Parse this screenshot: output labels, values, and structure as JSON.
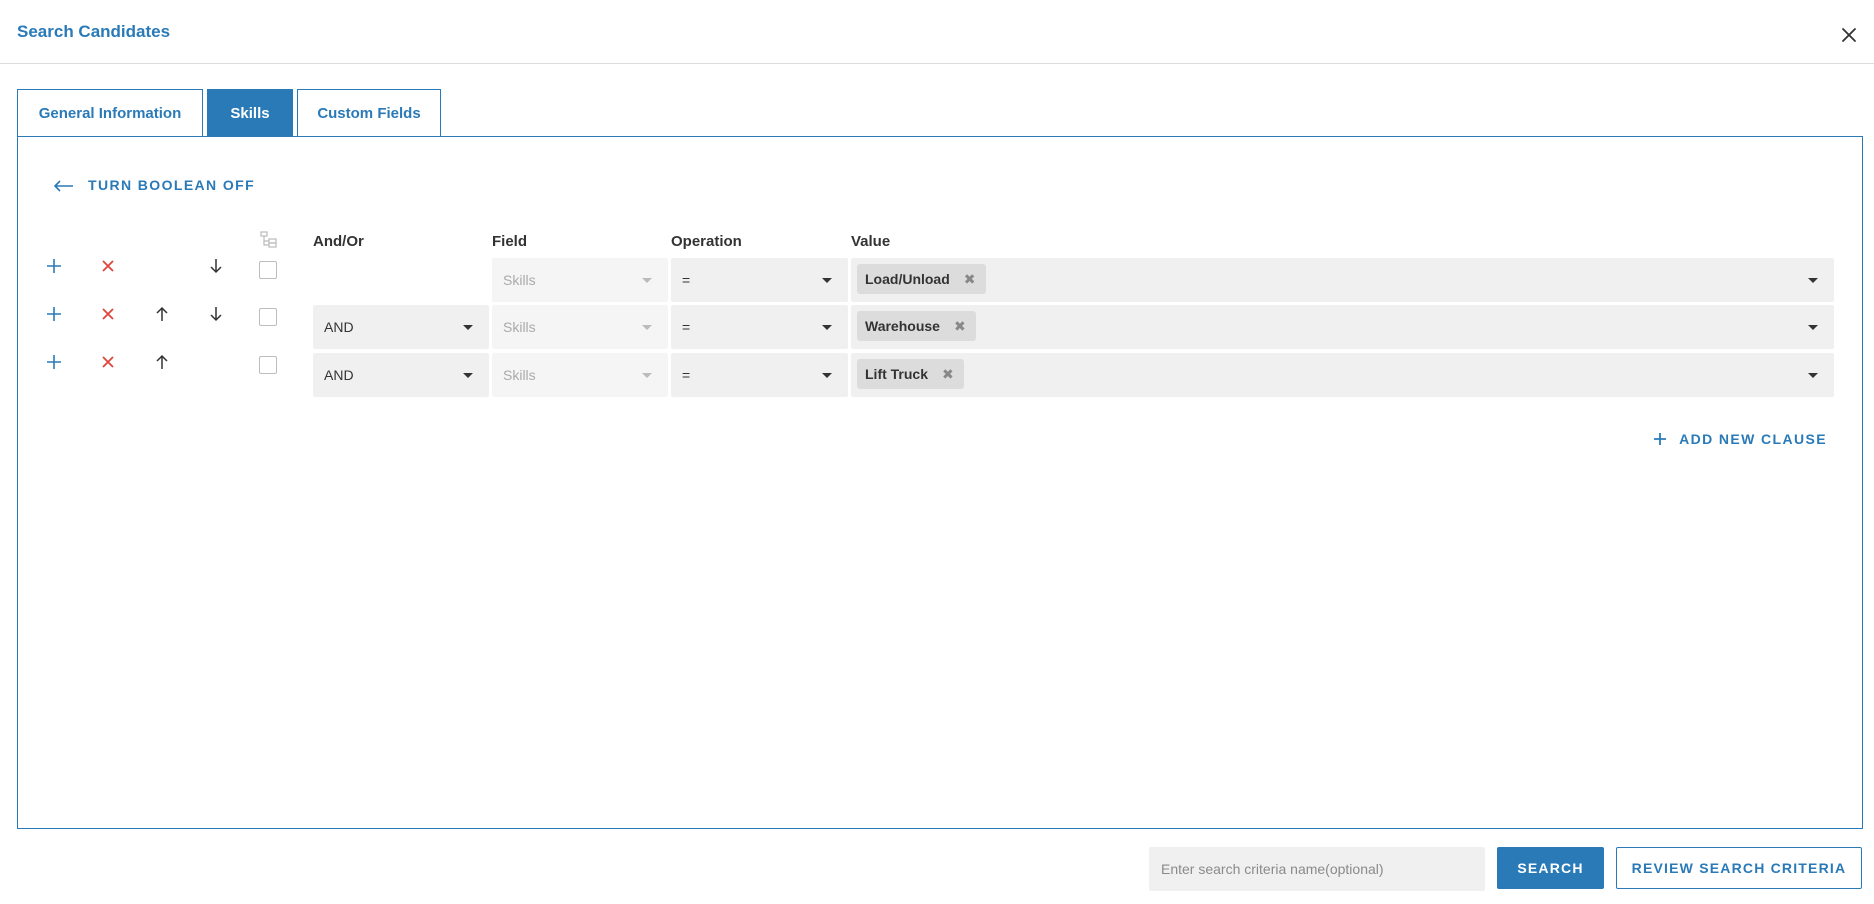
{
  "dialog": {
    "title": "Search Candidates"
  },
  "tabs": [
    {
      "label": "General Information",
      "active": false
    },
    {
      "label": "Skills",
      "active": true
    },
    {
      "label": "Custom Fields",
      "active": false
    }
  ],
  "boolean_toggle": {
    "label": "TURN BOOLEAN OFF"
  },
  "columns": {
    "and_or": "And/Or",
    "field": "Field",
    "operation": "Operation",
    "value": "Value"
  },
  "clauses": [
    {
      "and_or": "",
      "field": "Skills",
      "operation": "=",
      "values": [
        "Load/Unload"
      ]
    },
    {
      "and_or": "AND",
      "field": "Skills",
      "operation": "=",
      "values": [
        "Warehouse"
      ]
    },
    {
      "and_or": "AND",
      "field": "Skills",
      "operation": "=",
      "values": [
        "Lift Truck"
      ]
    }
  ],
  "add_clause": {
    "label": "ADD NEW CLAUSE"
  },
  "footer": {
    "criteria_placeholder": "Enter search criteria name(optional)",
    "search_label": "SEARCH",
    "review_label": "REVIEW SEARCH CRITERIA"
  },
  "colors": {
    "accent": "#2a7ab8",
    "danger": "#e0453c",
    "field_bg": "#f0f0f0",
    "chip_bg": "#dcdcdc"
  }
}
